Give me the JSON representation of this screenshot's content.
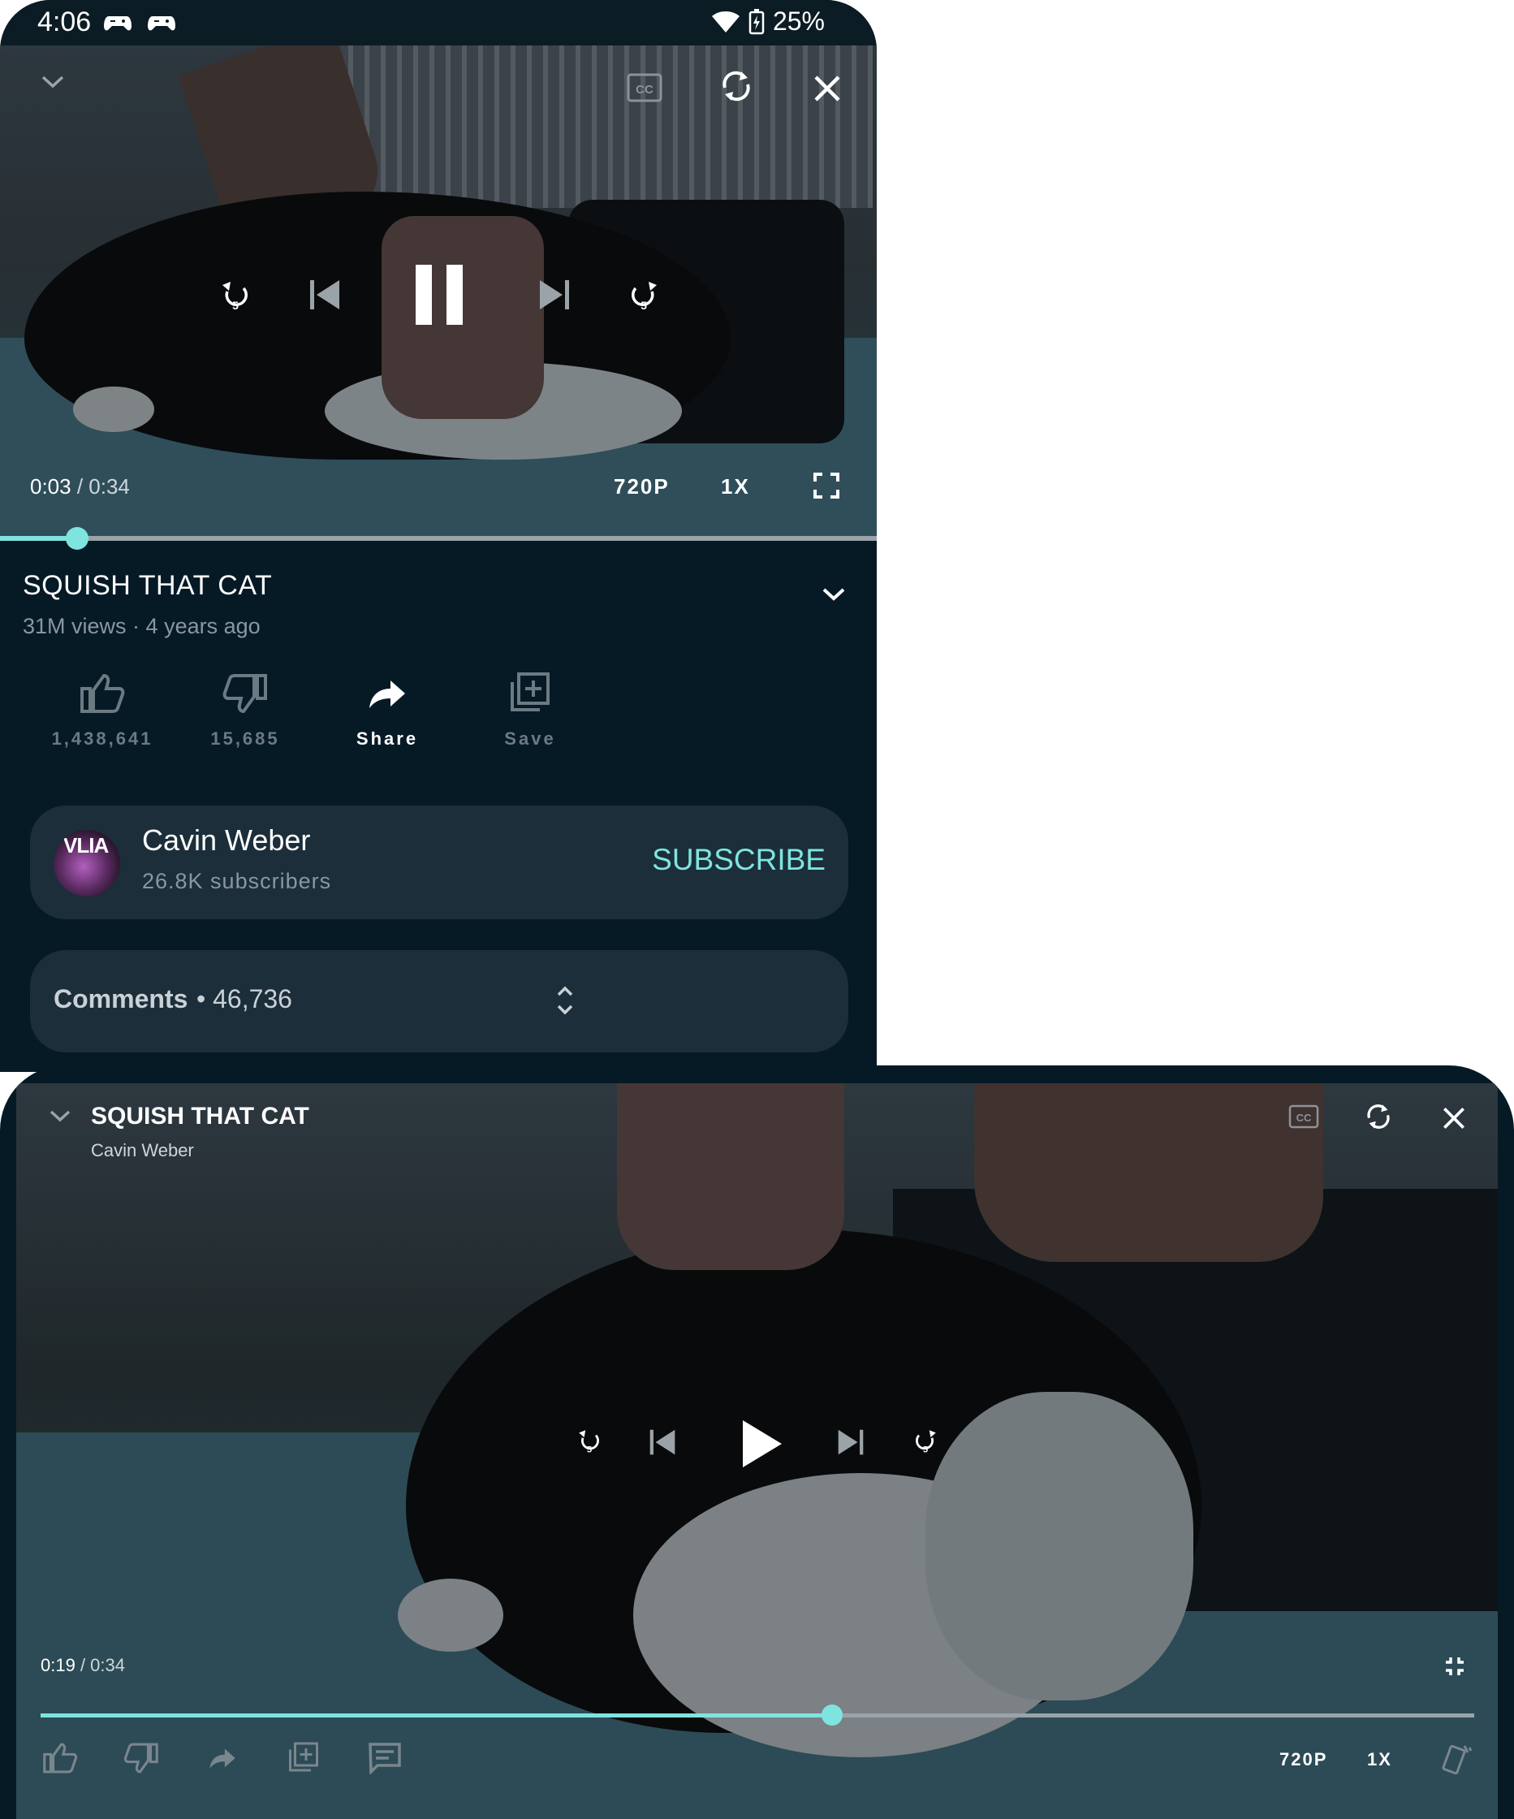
{
  "status_bar": {
    "time": "4:06",
    "battery": "25%",
    "icons": [
      "game-controller-icon",
      "game-controller-icon",
      "wifi-icon",
      "battery-charging-icon"
    ]
  },
  "player": {
    "current_time": "0:03",
    "separator": " / ",
    "duration": "0:34",
    "quality": "720P",
    "speed": "1X",
    "progress_fraction": 0.088
  },
  "video": {
    "title": "SQUISH THAT CAT",
    "views": "31M views",
    "meta_separator": " · ",
    "age": "4 years ago"
  },
  "actions": {
    "likes": "1,438,641",
    "dislikes": "15,685",
    "share": "Share",
    "save": "Save"
  },
  "channel": {
    "avatar_text": "VLIA",
    "name": "Cavin Weber",
    "subscribers": "26.8K subscribers",
    "subscribe_label": "SUBSCRIBE"
  },
  "comments": {
    "label": "Comments",
    "separator": " • ",
    "count": "46,736"
  },
  "landscape": {
    "title": "SQUISH THAT CAT",
    "channel": "Cavin Weber",
    "current_time": "0:19",
    "separator": " / ",
    "duration": "0:34",
    "quality": "720P",
    "speed": "1X",
    "progress_fraction": 0.552
  },
  "colors": {
    "accent": "#7fe4df",
    "background": "#061a26",
    "card": "#1b2e3a"
  }
}
